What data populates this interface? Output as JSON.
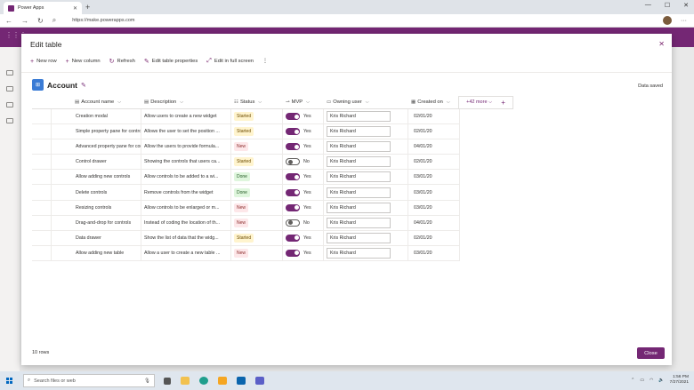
{
  "browser": {
    "tab_title": "Power Apps",
    "url": "https://make.powerapps.com"
  },
  "modal": {
    "title": "Edit table",
    "toolbar": {
      "new_row": "New row",
      "new_column": "New column",
      "refresh": "Refresh",
      "edit_properties": "Edit table properties",
      "full_screen": "Edit in full screen"
    },
    "table_name": "Account",
    "save_status": "Data saved",
    "columns": [
      "Account name",
      "Description",
      "Status",
      "MVP",
      "Owning user",
      "Created on"
    ],
    "more_columns": "+42 more",
    "rows": [
      {
        "name": "Creation modal",
        "desc": "Allow users to create a new widget",
        "status": "Started",
        "mvp": "Yes",
        "owner": "Kris Richard",
        "created": "02/01/20"
      },
      {
        "name": "Simple property pane for controls",
        "desc": "Allows the user to set the position ...",
        "status": "Started",
        "mvp": "Yes",
        "owner": "Kris Richard",
        "created": "02/01/20"
      },
      {
        "name": "Advanced property pane for contr...",
        "desc": "Allow the users to provide formula...",
        "status": "New",
        "mvp": "Yes",
        "owner": "Kris Richard",
        "created": "04/01/20"
      },
      {
        "name": "Control drawer",
        "desc": "Showing the controls that users ca...",
        "status": "Started",
        "mvp": "No",
        "owner": "Kris Richard",
        "created": "02/01/20"
      },
      {
        "name": "Allow adding new controls",
        "desc": "Allow controls to be added to a wi...",
        "status": "Done",
        "mvp": "Yes",
        "owner": "Kris Richard",
        "created": "03/01/20"
      },
      {
        "name": "Delete controls",
        "desc": "Remove controls from the widget",
        "status": "Done",
        "mvp": "Yes",
        "owner": "Kris Richard",
        "created": "03/01/20"
      },
      {
        "name": "Resizing controls",
        "desc": "Allow controls to be enlarged or m...",
        "status": "New",
        "mvp": "Yes",
        "owner": "Kris Richard",
        "created": "03/01/20"
      },
      {
        "name": "Drag-and-drop for controls",
        "desc": "Instead of coding the location of th...",
        "status": "New",
        "mvp": "No",
        "owner": "Kris Richard",
        "created": "04/01/20"
      },
      {
        "name": "Data drawer",
        "desc": "Show the list of data that the widg...",
        "status": "Started",
        "mvp": "Yes",
        "owner": "Kris Richard",
        "created": "02/01/20"
      },
      {
        "name": "Allow adding new table",
        "desc": "Allow a user to create a new table ...",
        "status": "New",
        "mvp": "Yes",
        "owner": "Kris Richard",
        "created": "03/01/20"
      }
    ],
    "row_count": "10 rows",
    "close_label": "Close"
  },
  "taskbar": {
    "search_placeholder": "Search files or web",
    "time": "1:56 PM",
    "date": "7/27/2021"
  },
  "colors": {
    "brand": "#742774",
    "started": "#fff4ce",
    "done": "#dff6dd",
    "new": "#fde7e9"
  }
}
